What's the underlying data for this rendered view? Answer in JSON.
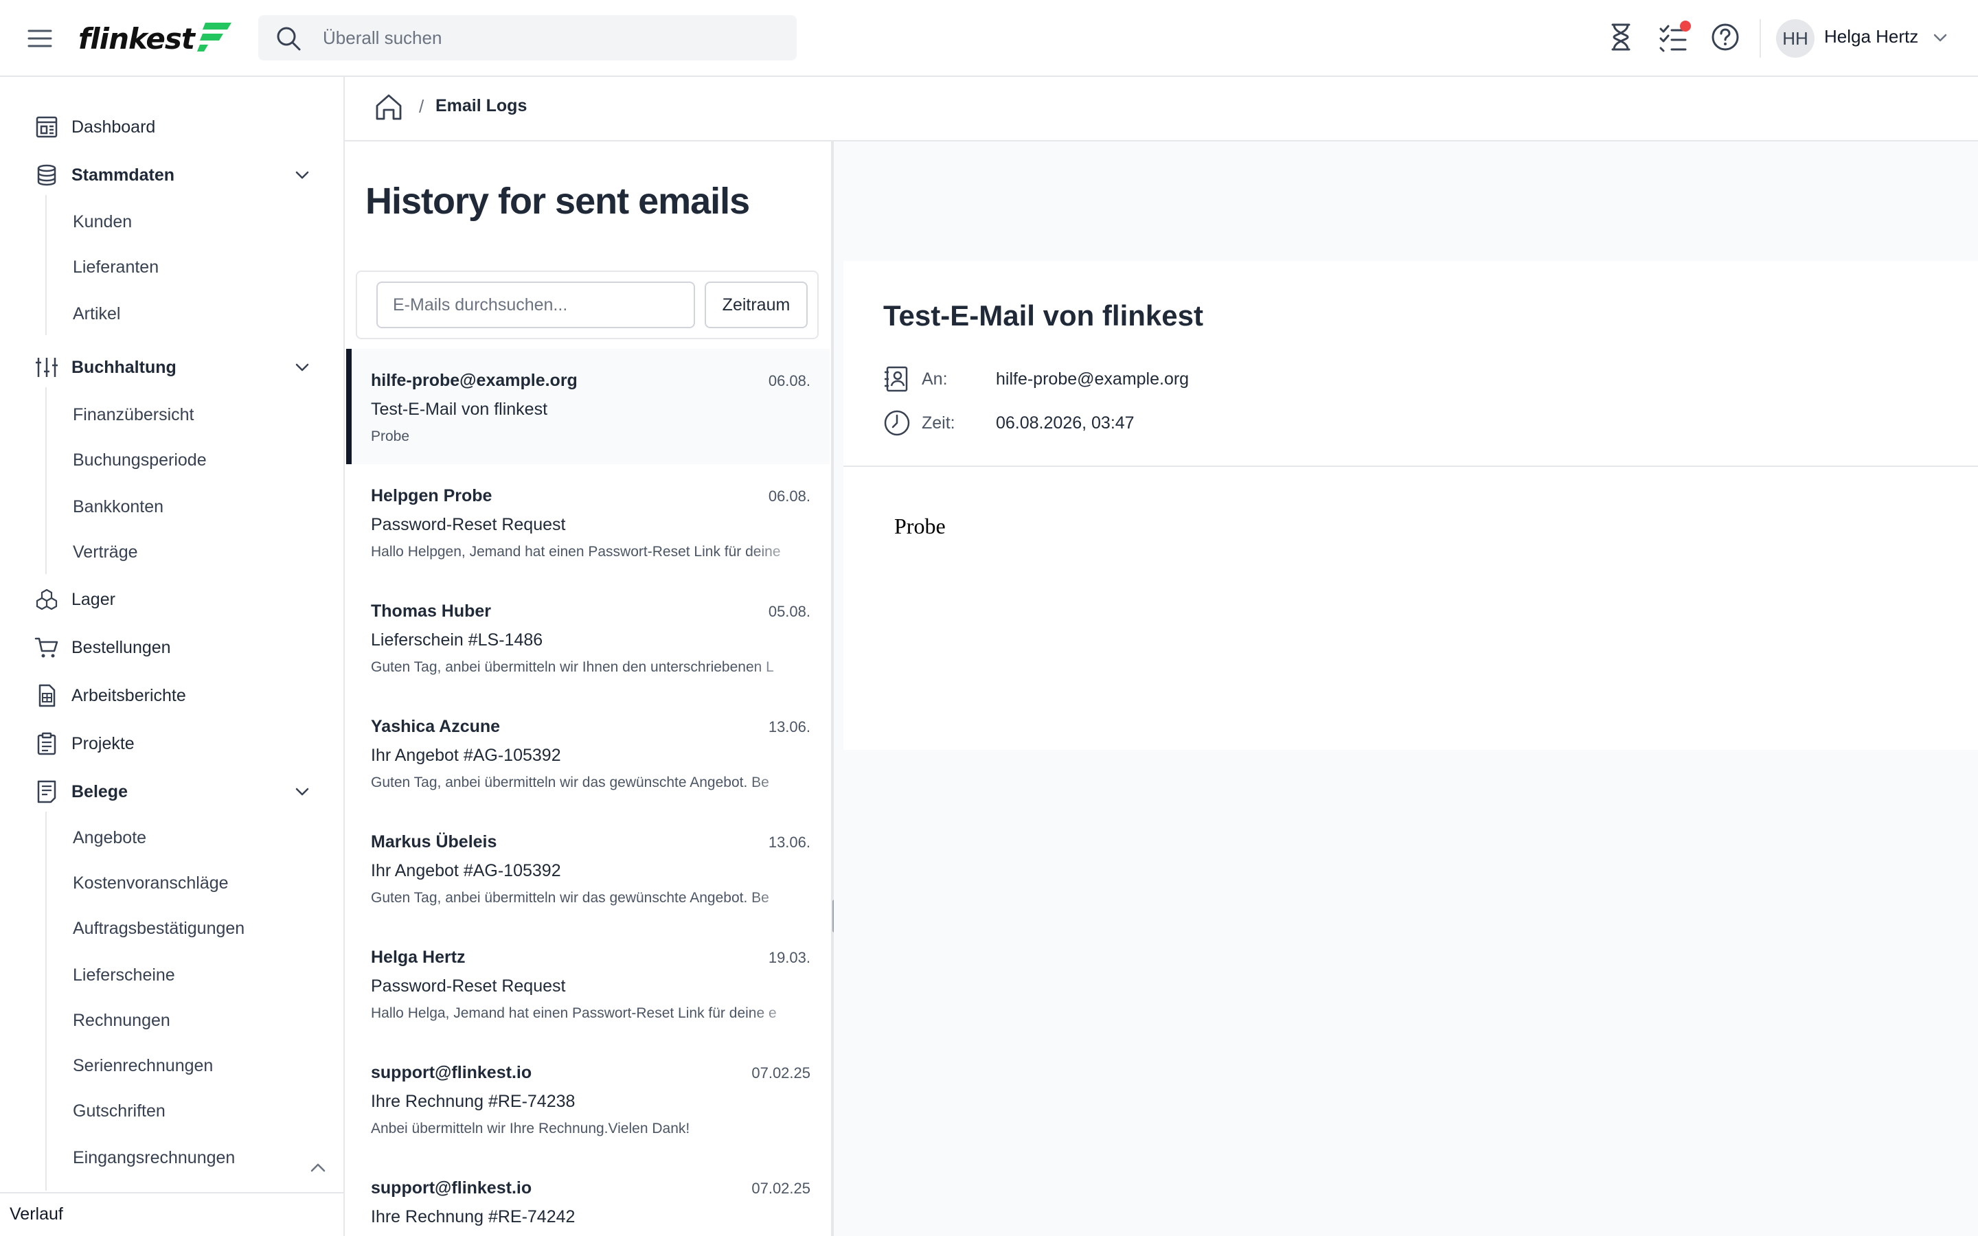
{
  "header": {
    "logo_text": "flinkest",
    "search_placeholder": "Überall suchen",
    "user": {
      "initials": "HH",
      "name": "Helga Hertz"
    },
    "icons": [
      "menu-icon",
      "hourglass-icon",
      "tasks-icon",
      "help-icon",
      "chevron-down-icon"
    ],
    "notification_color": "#ef4444",
    "brand_color": "#22c55e"
  },
  "sidebar": {
    "items": [
      {
        "label": "Dashboard",
        "icon": "dashboard-icon"
      },
      {
        "label": "Stammdaten",
        "icon": "database-icon",
        "expanded": true,
        "children": [
          "Kunden",
          "Lieferanten",
          "Artikel"
        ]
      },
      {
        "label": "Buchhaltung",
        "icon": "sliders-icon",
        "expanded": true,
        "children": [
          "Finanzübersicht",
          "Buchungsperiode",
          "Bankkonten",
          "Verträge"
        ]
      },
      {
        "label": "Lager",
        "icon": "boxes-icon"
      },
      {
        "label": "Bestellungen",
        "icon": "cart-icon"
      },
      {
        "label": "Arbeitsberichte",
        "icon": "report-icon"
      },
      {
        "label": "Projekte",
        "icon": "clipboard-icon"
      },
      {
        "label": "Belege",
        "icon": "receipt-icon",
        "expanded": true,
        "children": [
          "Angebote",
          "Kostenvoranschläge",
          "Auftragsbestätigungen",
          "Lieferscheine",
          "Rechnungen",
          "Serienrechnungen",
          "Gutschriften",
          "Eingangsrechnungen"
        ]
      }
    ],
    "history_label": "Verlauf"
  },
  "breadcrumb": {
    "current": "Email Logs",
    "separator": "/"
  },
  "list": {
    "title": "History for sent emails",
    "search_placeholder": "E-Mails durchsuchen...",
    "period_button": "Zeitraum",
    "emails": [
      {
        "from": "hilfe-probe@example.org",
        "date": "06.08.",
        "subject": "Test-E-Mail von flinkest",
        "preview": "Probe",
        "selected": true
      },
      {
        "from": "Helpgen Probe",
        "date": "06.08.",
        "subject": "Password-Reset Request",
        "preview": "Hallo Helpgen, Jemand hat einen Passwort-Reset Link für deine"
      },
      {
        "from": "Thomas Huber",
        "date": "05.08.",
        "subject": "Lieferschein #LS-1486",
        "preview": "Guten Tag, anbei übermitteln wir Ihnen den unterschriebenen L"
      },
      {
        "from": "Yashica Azcune",
        "date": "13.06.",
        "subject": "Ihr Angebot #AG-105392",
        "preview": "Guten Tag, anbei übermitteln wir das gewünschte Angebot. Be"
      },
      {
        "from": "Markus Übeleis",
        "date": "13.06.",
        "subject": "Ihr Angebot #AG-105392",
        "preview": "Guten Tag, anbei übermitteln wir das gewünschte Angebot. Be"
      },
      {
        "from": "Helga Hertz",
        "date": "19.03.",
        "subject": "Password-Reset Request",
        "preview": "Hallo Helga, Jemand hat einen Passwort-Reset Link für deine e"
      },
      {
        "from": "support@flinkest.io",
        "date": "07.02.25",
        "subject": "Ihre Rechnung #RE-74238",
        "preview": "Anbei übermitteln wir Ihre Rechnung.Vielen Dank!"
      },
      {
        "from": "support@flinkest.io",
        "date": "07.02.25",
        "subject": "Ihre Rechnung #RE-74242",
        "preview": ""
      }
    ]
  },
  "detail": {
    "subject": "Test-E-Mail von flinkest",
    "to_label": "An:",
    "to_value": "hilfe-probe@example.org",
    "time_label": "Zeit:",
    "time_value": "06.08.2026, 03:47",
    "body": "Probe"
  }
}
